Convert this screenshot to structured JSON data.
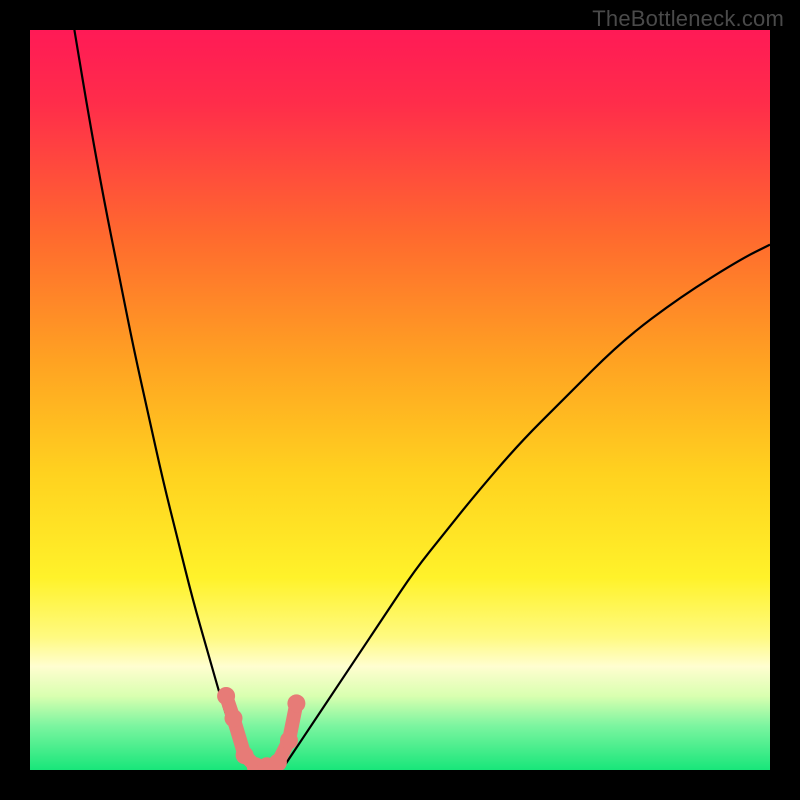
{
  "watermark": "TheBottleneck.com",
  "colors": {
    "frame": "#000000",
    "gradient_stops": [
      {
        "offset": 0.0,
        "color": "#ff1a56"
      },
      {
        "offset": 0.1,
        "color": "#ff2d4a"
      },
      {
        "offset": 0.28,
        "color": "#ff6a2e"
      },
      {
        "offset": 0.45,
        "color": "#ffa322"
      },
      {
        "offset": 0.6,
        "color": "#ffd21f"
      },
      {
        "offset": 0.74,
        "color": "#fff22a"
      },
      {
        "offset": 0.82,
        "color": "#fffa80"
      },
      {
        "offset": 0.86,
        "color": "#fffed0"
      },
      {
        "offset": 0.9,
        "color": "#d9ffb0"
      },
      {
        "offset": 0.94,
        "color": "#7cf5a0"
      },
      {
        "offset": 1.0,
        "color": "#18e67a"
      }
    ],
    "curve_stroke": "#000000",
    "marker_fill": "#e77b77"
  },
  "chart_data": {
    "type": "line",
    "title": "",
    "xlabel": "",
    "ylabel": "",
    "xlim": [
      0,
      100
    ],
    "ylim": [
      0,
      100
    ],
    "note": "Values are approximate, read from pixel positions; y = bottleneck % (0 at bottom, 100 at top).",
    "series": [
      {
        "name": "left-curve",
        "x": [
          6,
          8,
          10,
          12,
          14,
          16,
          18,
          20,
          22,
          24,
          26,
          27,
          28,
          29,
          30
        ],
        "y": [
          100,
          88,
          77,
          67,
          57,
          48,
          39,
          31,
          23,
          16,
          9,
          6,
          3,
          1,
          0
        ]
      },
      {
        "name": "right-curve",
        "x": [
          34,
          36,
          38,
          40,
          44,
          48,
          52,
          56,
          60,
          66,
          72,
          80,
          88,
          96,
          100
        ],
        "y": [
          0,
          3,
          6,
          9,
          15,
          21,
          27,
          32,
          37,
          44,
          50,
          58,
          64,
          69,
          71
        ]
      },
      {
        "name": "optimal-markers",
        "x": [
          26.5,
          27.5,
          29,
          30.5,
          32,
          33.5,
          35,
          36
        ],
        "y": [
          10,
          7,
          2,
          0.5,
          0.5,
          1,
          4,
          9
        ]
      }
    ]
  }
}
